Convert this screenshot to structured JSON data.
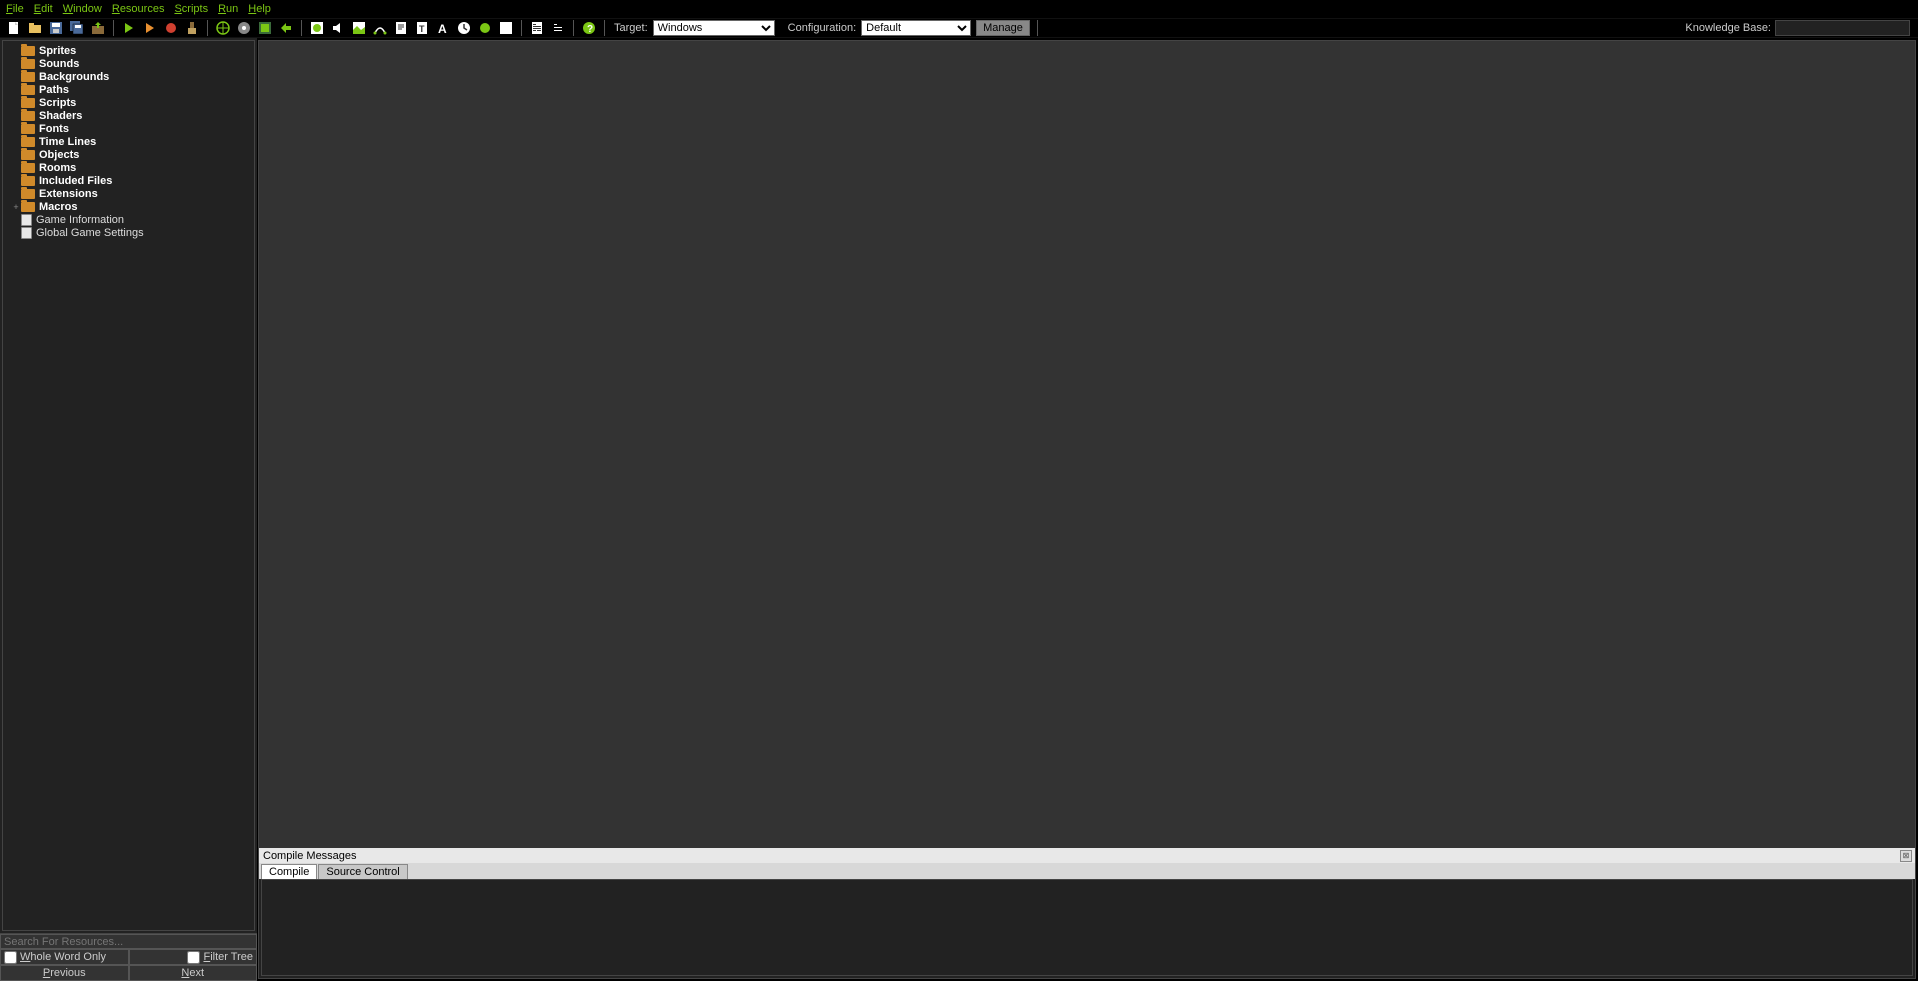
{
  "menu": {
    "items": [
      {
        "label": "File",
        "ul": "F",
        "rest": "ile"
      },
      {
        "label": "Edit",
        "ul": "E",
        "rest": "dit"
      },
      {
        "label": "Window",
        "ul": "W",
        "rest": "indow"
      },
      {
        "label": "Resources",
        "ul": "R",
        "rest": "esources"
      },
      {
        "label": "Scripts",
        "ul": "S",
        "rest": "cripts"
      },
      {
        "label": "Run",
        "ul": "R",
        "rest": "un"
      },
      {
        "label": "Help",
        "ul": "H",
        "rest": "elp"
      }
    ]
  },
  "toolbar": {
    "target_label": "Target:",
    "target_value": "Windows",
    "config_label": "Configuration:",
    "config_value": "Default",
    "manage_label": "Manage",
    "kb_label": "Knowledge Base:",
    "kb_value": ""
  },
  "tree": {
    "items": [
      {
        "label": "Sprites",
        "type": "folder",
        "bold": true,
        "expander": ""
      },
      {
        "label": "Sounds",
        "type": "folder",
        "bold": true,
        "expander": ""
      },
      {
        "label": "Backgrounds",
        "type": "folder",
        "bold": true,
        "expander": ""
      },
      {
        "label": "Paths",
        "type": "folder",
        "bold": true,
        "expander": ""
      },
      {
        "label": "Scripts",
        "type": "folder",
        "bold": true,
        "expander": ""
      },
      {
        "label": "Shaders",
        "type": "folder",
        "bold": true,
        "expander": ""
      },
      {
        "label": "Fonts",
        "type": "folder",
        "bold": true,
        "expander": ""
      },
      {
        "label": "Time Lines",
        "type": "folder",
        "bold": true,
        "expander": ""
      },
      {
        "label": "Objects",
        "type": "folder",
        "bold": true,
        "expander": ""
      },
      {
        "label": "Rooms",
        "type": "folder",
        "bold": true,
        "expander": ""
      },
      {
        "label": "Included Files",
        "type": "folder",
        "bold": true,
        "expander": ""
      },
      {
        "label": "Extensions",
        "type": "folder",
        "bold": true,
        "expander": ""
      },
      {
        "label": "Macros",
        "type": "folder",
        "bold": true,
        "expander": "+"
      },
      {
        "label": "Game Information",
        "type": "doc",
        "bold": false,
        "expander": ""
      },
      {
        "label": "Global Game Settings",
        "type": "doc",
        "bold": false,
        "expander": ""
      }
    ]
  },
  "search": {
    "placeholder": "Search For Resources...",
    "whole_word": "hole Word Only",
    "whole_word_ul": "W",
    "filter_tree": "ilter Tree",
    "filter_tree_ul": "F",
    "prev": "revious",
    "prev_ul": "P",
    "next": "ext",
    "next_ul": "N"
  },
  "compile": {
    "title": "Compile Messages",
    "tabs": [
      {
        "label": "Compile",
        "active": true
      },
      {
        "label": "Source Control",
        "active": false
      }
    ]
  }
}
